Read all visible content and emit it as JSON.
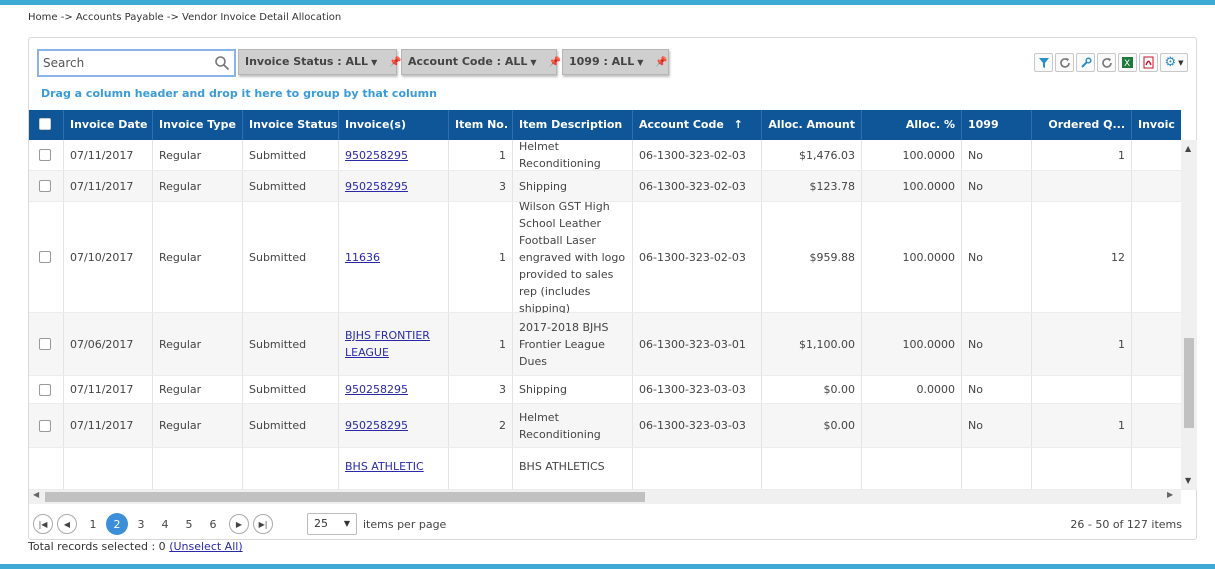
{
  "breadcrumb": "Home -> Accounts Payable -> Vendor Invoice Detail Allocation",
  "toolbar": {
    "search_placeholder": "Search",
    "filters": [
      {
        "label": "Invoice Status : ALL"
      },
      {
        "label": "Account Code : ALL"
      },
      {
        "label": "1099 : ALL"
      }
    ]
  },
  "group_hint": "Drag a column header and drop it here to group by that column",
  "columns": [
    "Invoice Date",
    "Invoice Type",
    "Invoice Status",
    "Invoice(s)",
    "Item No.",
    "Item Description",
    "Account Code",
    "Alloc. Amount",
    "Alloc. %",
    "1099",
    "Ordered Q...",
    "Invoic"
  ],
  "sort_indicator": "↑",
  "rows": [
    {
      "date": "07/11/2017",
      "type": "Regular",
      "status": "Submitted",
      "invoice": "950258295",
      "item_no": "1",
      "desc": "Helmet Reconditioning",
      "account": "06-1300-323-02-03",
      "amount": "$1,476.03",
      "pct": "100.0000",
      "f1099": "No",
      "ordered": "1"
    },
    {
      "date": "07/11/2017",
      "type": "Regular",
      "status": "Submitted",
      "invoice": "950258295",
      "item_no": "3",
      "desc": "Shipping",
      "account": "06-1300-323-02-03",
      "amount": "$123.78",
      "pct": "100.0000",
      "f1099": "No",
      "ordered": ""
    },
    {
      "date": "07/10/2017",
      "type": "Regular",
      "status": "Submitted",
      "invoice": "11636",
      "item_no": "1",
      "desc": "Wilson GST High School Leather Football Laser engraved with logo provided to sales rep (includes shipping)",
      "account": "06-1300-323-02-03",
      "amount": "$959.88",
      "pct": "100.0000",
      "f1099": "No",
      "ordered": "12"
    },
    {
      "date": "07/06/2017",
      "type": "Regular",
      "status": "Submitted",
      "invoice": "BJHS FRONTIER LEAGUE",
      "item_no": "1",
      "desc": "2017-2018 BJHS Frontier League Dues",
      "account": "06-1300-323-03-01",
      "amount": "$1,100.00",
      "pct": "100.0000",
      "f1099": "No",
      "ordered": "1"
    },
    {
      "date": "07/11/2017",
      "type": "Regular",
      "status": "Submitted",
      "invoice": "950258295",
      "item_no": "3",
      "desc": "Shipping",
      "account": "06-1300-323-03-03",
      "amount": "$0.00",
      "pct": "0.0000",
      "f1099": "No",
      "ordered": ""
    },
    {
      "date": "07/11/2017",
      "type": "Regular",
      "status": "Submitted",
      "invoice": "950258295",
      "item_no": "2",
      "desc": "Helmet Reconditioning",
      "account": "06-1300-323-03-03",
      "amount": "$0.00",
      "pct": "",
      "f1099": "No",
      "ordered": "1"
    },
    {
      "date": "",
      "type": "",
      "status": "",
      "invoice": "BHS ATHLETIC",
      "item_no": "",
      "desc": "BHS ATHLETICS",
      "account": "",
      "amount": "",
      "pct": "",
      "f1099": "",
      "ordered": ""
    }
  ],
  "pager": {
    "pages": [
      "1",
      "2",
      "3",
      "4",
      "5",
      "6"
    ],
    "current": "2",
    "page_size": "25",
    "per_page_label": "items per page",
    "item_count": "26 - 50 of 127 items"
  },
  "footer": {
    "selected_label": "Total records selected : 0",
    "unselect_label": "(Unselect All)"
  },
  "colors": {
    "header_bg": "#0f5699",
    "accent_bar": "#3fa9d6",
    "hint_text": "#3a9bd5",
    "active_page": "#3a8fd8"
  }
}
